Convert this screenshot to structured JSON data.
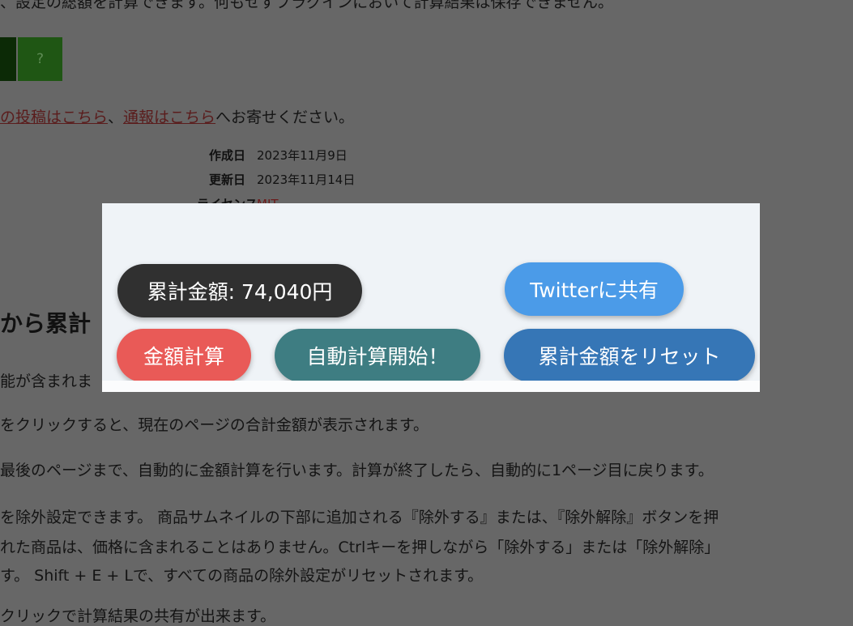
{
  "page": {
    "intro_line": "、設定の総額を計算できます。何もせずプラグインにおいて計算結果は保存できません。",
    "help_button": "?",
    "links": {
      "post_link": "の投稿はこちら",
      "sep": "、",
      "report_link": "通報はこちら",
      "suffix": "へお寄せください。"
    },
    "meta": {
      "created_label": "作成日",
      "created_value": "2023年11月9日",
      "updated_label": "更新日",
      "updated_value": "2023年11月14日",
      "license_label": "ライセンス",
      "license_value": "MIT"
    },
    "heading": "から累計",
    "body_lines": [
      "能が含まれま",
      "をクリックすると、現在のページの合計金額が表示されます。",
      "最後のページまで、自動的に金額計算を行います。計算が終了したら、自動的に1ページ目に戻ります。",
      "を除外設定できます。 商品サムネイルの下部に追加される『除外する』または、『除外解除』ボタンを押",
      "れた商品は、価格に含まれることはありません。Ctrlキーを押しながら「除外する」または「除外解除」",
      "す。 Shift + E + Lで、すべての商品の除外設定がリセットされます。",
      "クリックで計算結果の共有が出来ます。"
    ]
  },
  "overlay": {
    "total_label": "累計金額: 74,040円",
    "twitter_button": "Twitterに共有",
    "calc_button": "金額計算",
    "auto_button": "自動計算開始！",
    "reset_button": "累計金額をリセット"
  },
  "colors": {
    "dim_background": "#676767",
    "total_pill": "#303030",
    "twitter_pill": "#4b9be8",
    "calc_pill": "#e95a57",
    "auto_pill": "#3e7d82",
    "reset_pill": "#3676b6"
  }
}
